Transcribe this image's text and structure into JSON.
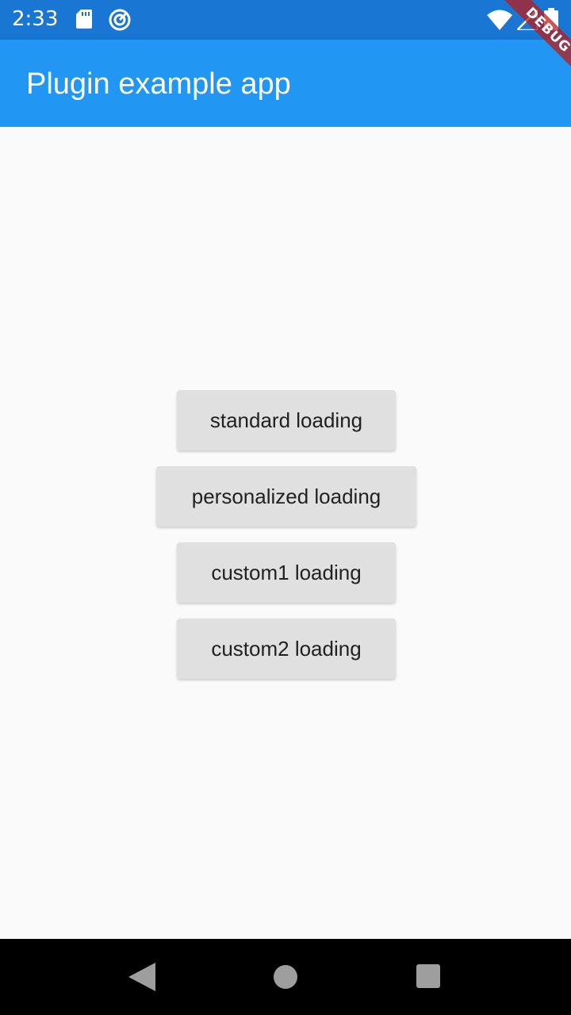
{
  "status_bar": {
    "time": "2:33",
    "icons": [
      "sd-card-icon",
      "sync-icon",
      "wifi-icon",
      "signal-icon",
      "battery-icon"
    ],
    "color": "#1976d2"
  },
  "app_bar": {
    "title": "Plugin example app",
    "color": "#2196f3"
  },
  "debug_banner": {
    "label": "DEBUG"
  },
  "buttons": [
    {
      "label": "standard loading"
    },
    {
      "label": "personalized loading"
    },
    {
      "label": "custom1 loading"
    },
    {
      "label": "custom2 loading"
    }
  ],
  "nav_bar": {
    "icons": [
      "back-icon",
      "home-icon",
      "recents-icon"
    ]
  }
}
